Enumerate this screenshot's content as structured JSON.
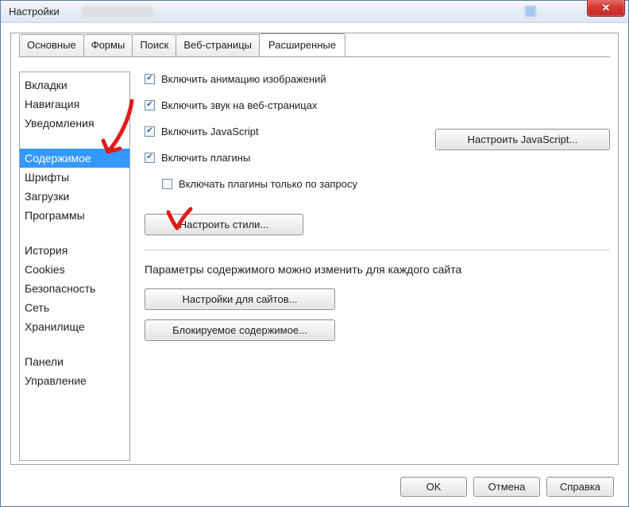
{
  "window": {
    "title": "Настройки"
  },
  "tabs": [
    "Основные",
    "Формы",
    "Поиск",
    "Веб-страницы",
    "Расширенные"
  ],
  "active_tab_index": 4,
  "sidebar": {
    "groups": [
      [
        "Вкладки",
        "Навигация",
        "Уведомления"
      ],
      [
        "Содержимое",
        "Шрифты",
        "Загрузки",
        "Программы"
      ],
      [
        "История",
        "Cookies",
        "Безопасность",
        "Сеть",
        "Хранилище"
      ],
      [
        "Панели",
        "Управление"
      ]
    ],
    "selected": "Содержимое"
  },
  "options": {
    "anim": {
      "label": "Включить анимацию изображений",
      "checked": true
    },
    "sound": {
      "label": "Включить звук на веб-страницах",
      "checked": true
    },
    "js": {
      "label": "Включить JavaScript",
      "checked": true
    },
    "plugins": {
      "label": "Включить плагины",
      "checked": true
    },
    "plugins_click": {
      "label": "Включать плагины только по запросу",
      "checked": false
    }
  },
  "buttons": {
    "js_settings": "Настроить JavaScript...",
    "styles": "Настроить стили...",
    "site_settings": "Настройки для сайтов...",
    "blocked": "Блокируемое содержимое...",
    "ok": "OK",
    "cancel": "Отмена",
    "help": "Справка"
  },
  "note": "Параметры содержимого можно изменить для каждого сайта"
}
